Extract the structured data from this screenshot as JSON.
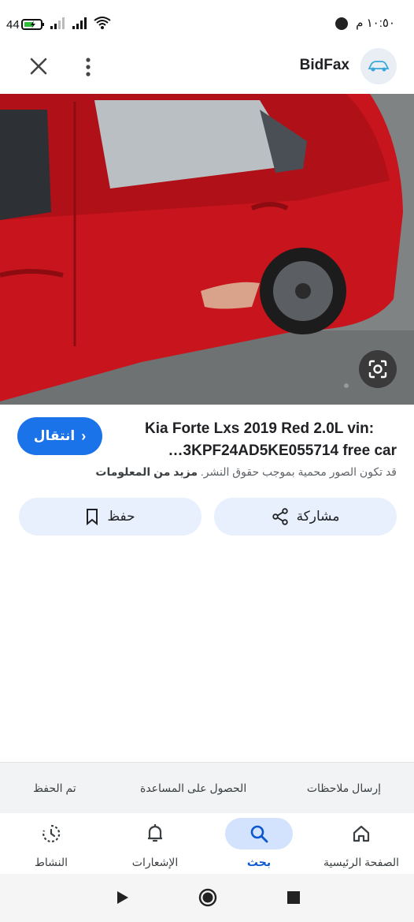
{
  "status_bar": {
    "time": "١٠:٥٠ م",
    "battery": "44"
  },
  "header": {
    "brand": "BidFax",
    "close_icon": "close-icon",
    "more_icon": "more-vert-icon"
  },
  "result": {
    "title_line1": "Kia Forte Lxs 2019 Red 2.0L vin:",
    "title_line2": "3KPF24AD5KE055714 free car…",
    "go_label": "انتقال",
    "copyright_text": "قد تكون الصور محمية بموجب حقوق النشر.",
    "more_info": "مزيد من المعلومات",
    "share_label": "مشاركة",
    "save_label": "حفظ"
  },
  "footer_links": {
    "feedback": "إرسال ملاحظات",
    "help": "الحصول على المساعدة",
    "saved": "تم الحفظ"
  },
  "bottom_nav": {
    "items": [
      {
        "label": "الصفحة الرئيسية",
        "icon": "home-icon"
      },
      {
        "label": "بحث",
        "icon": "search-icon"
      },
      {
        "label": "الإشعارات",
        "icon": "bell-icon"
      },
      {
        "label": "النشاط",
        "icon": "activity-icon"
      }
    ],
    "active_index": 1
  },
  "colors": {
    "accent": "#1a73e8",
    "car_red": "#c8141c"
  }
}
